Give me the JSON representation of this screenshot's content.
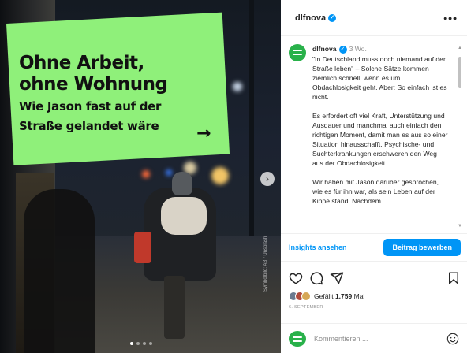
{
  "post": {
    "headline_line1": "Ohne Arbeit,",
    "headline_line2": "ohne Wohnung",
    "subline_line1": "Wie Jason fast auf der",
    "subline_line2": "Straße gelandet wäre",
    "arrow": "→",
    "credit": "Symbolbild: AB / Unsplash",
    "carousel_count": 4,
    "carousel_active": 1
  },
  "header": {
    "username": "dlfnova",
    "more_label": "•••"
  },
  "caption": {
    "username": "dlfnova",
    "time": "3 Wo.",
    "paragraphs": [
      "\"In Deutschland muss doch niemand auf der Straße leben\" – Solche Sätze kommen ziemlich schnell, wenn es um Obdachlosigkeit geht. Aber: So einfach ist es nicht.",
      "Es erfordert oft viel Kraft, Unterstützung und Ausdauer und manchmal auch einfach den richtigen Moment, damit man es aus so einer Situation hinausschafft. Psychische- und Suchterkrankungen erschweren den Weg aus der Obdachlosigkeit.",
      "Wir haben mit Jason darüber gesprochen, wie es für ihn war, als sein Leben auf der Kippe stand. Nachdem"
    ]
  },
  "actions": {
    "insights_label": "Insights ansehen",
    "promote_label": "Beitrag bewerben"
  },
  "likes": {
    "prefix": "Gefällt",
    "count": "1.759",
    "suffix": "Mal"
  },
  "date": "6. SEPTEMBER",
  "comment": {
    "placeholder": "Kommentieren ..."
  },
  "colors": {
    "accent": "#0095f6",
    "headline_bg": "#8ff07a",
    "brand_green": "#29b14a"
  }
}
